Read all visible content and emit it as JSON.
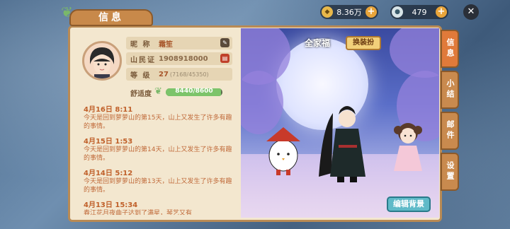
{
  "header": {
    "title": "信息"
  },
  "currency": [
    {
      "icon": "gold-coin-icon",
      "value": "8.36万"
    },
    {
      "icon": "jade-coin-icon",
      "value": "479"
    }
  ],
  "profile": {
    "nickname_label": "昵 称",
    "nickname": "霜笙",
    "id_label": "山民证",
    "id": "1908918000",
    "level_label": "等 级",
    "level": "27",
    "exp": "(7168/45350)",
    "comfort_label": "舒适度",
    "comfort_value": "8440/8600",
    "comfort_fraction": 0.98
  },
  "log": [
    {
      "date": "4月16日 8:11",
      "text": "今天是回到萝萝山的第15天，山上又发生了许多有趣的事情。"
    },
    {
      "date": "4月15日 1:53",
      "text": "今天是回到萝萝山的第14天，山上又发生了许多有趣的事情。"
    },
    {
      "date": "4月14日 5:12",
      "text": "今天是回到萝萝山的第13天，山上又发生了许多有趣的事情。"
    },
    {
      "date": "4月13日 15:34",
      "text": "春江花月夜曲子达到了满星，琴艺又有"
    }
  ],
  "scene": {
    "name": "全家福",
    "outfit_button": "换装扮",
    "edit_button": "编辑背景"
  },
  "tabs": [
    "信息",
    "小结",
    "邮件",
    "设置"
  ],
  "colors": {
    "accent": "#c98a4e",
    "panel": "#f3e7cf"
  }
}
